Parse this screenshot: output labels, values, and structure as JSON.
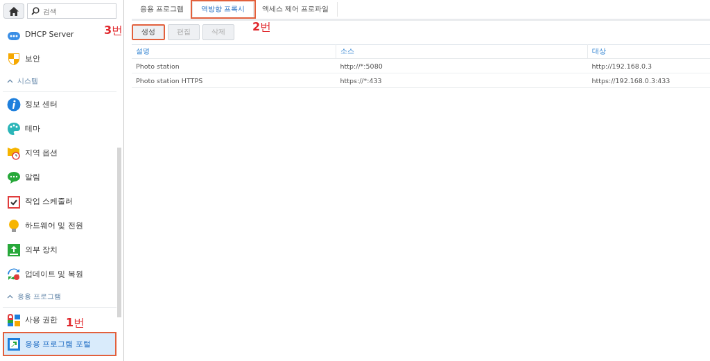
{
  "sidebar": {
    "search": {
      "placeholder": "검색"
    },
    "items": [
      {
        "kind": "item",
        "label": "DHCP Server",
        "selected": false
      },
      {
        "kind": "item",
        "label": "보안",
        "selected": false
      },
      {
        "kind": "section",
        "label": "시스템",
        "expanded": true
      },
      {
        "kind": "item",
        "label": "정보 센터",
        "selected": false
      },
      {
        "kind": "item",
        "label": "테마",
        "selected": false
      },
      {
        "kind": "item",
        "label": "지역 옵션",
        "selected": false
      },
      {
        "kind": "item",
        "label": "알림",
        "selected": false
      },
      {
        "kind": "item",
        "label": "작업 스케줄러",
        "selected": false
      },
      {
        "kind": "item",
        "label": "하드웨어 및 전원",
        "selected": false
      },
      {
        "kind": "item",
        "label": "외부 장치",
        "selected": false
      },
      {
        "kind": "item",
        "label": "업데이트 및 복원",
        "selected": false
      },
      {
        "kind": "section",
        "label": "응용 프로그램",
        "expanded": true
      },
      {
        "kind": "item",
        "label": "사용 권한",
        "selected": false
      },
      {
        "kind": "item",
        "label": "응용 프로그램 포털",
        "selected": true,
        "highlighted": true,
        "annotation": "**1**번"
      }
    ]
  },
  "tabs": [
    {
      "label": "응용 프로그램",
      "selected": false
    },
    {
      "label": "역방향 프록시",
      "selected": true,
      "highlighted": true,
      "annotation": "**2**번"
    },
    {
      "label": "액세스 제어 프로파일",
      "selected": false
    }
  ],
  "toolbar": {
    "buttons": [
      {
        "label": "생성",
        "disabled": false,
        "highlighted": true,
        "annotation": "**3**번"
      },
      {
        "label": "편집",
        "disabled": true
      },
      {
        "label": "삭제",
        "disabled": true
      }
    ]
  },
  "table": {
    "columns": [
      "설명",
      "소스",
      "대상"
    ],
    "rows": [
      [
        "Photo station",
        "http://*:5080",
        "http://192.168.0.3"
      ],
      [
        "Photo station HTTPS",
        "https://*:433",
        "https://192.168.0.3:433"
      ]
    ]
  }
}
